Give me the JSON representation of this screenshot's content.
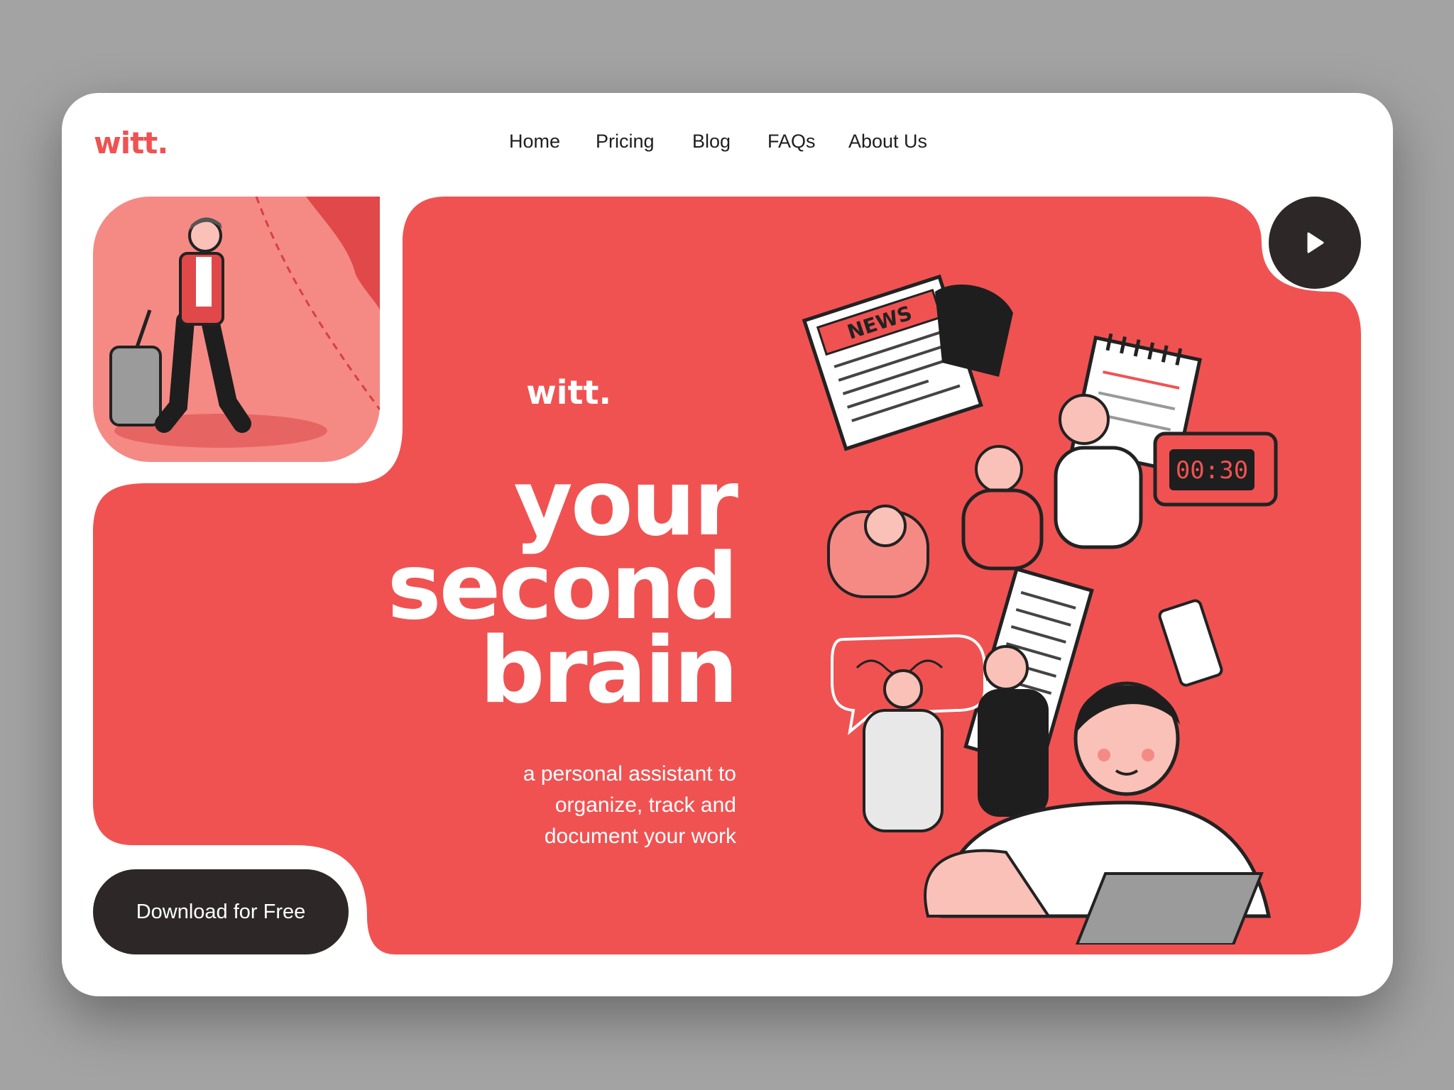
{
  "brand": {
    "logo": "witt.",
    "accent": "#f05252",
    "dark": "#2e2727"
  },
  "nav": {
    "items": [
      "Home",
      "Pricing",
      "Blog",
      "FAQs",
      "About Us"
    ]
  },
  "hero": {
    "logo": "witt.",
    "headline": [
      "your",
      "second",
      "brain"
    ],
    "subtext": [
      "a personal assistant to",
      "organize, track and",
      "document your work"
    ],
    "download_label": "Download for Free",
    "play_icon": "play-icon"
  },
  "illustrations": {
    "traveler": "traveler-illustration",
    "collage": "busy-people-collage-illustration",
    "news_label": "NEWS",
    "clock_time": "00:30"
  }
}
